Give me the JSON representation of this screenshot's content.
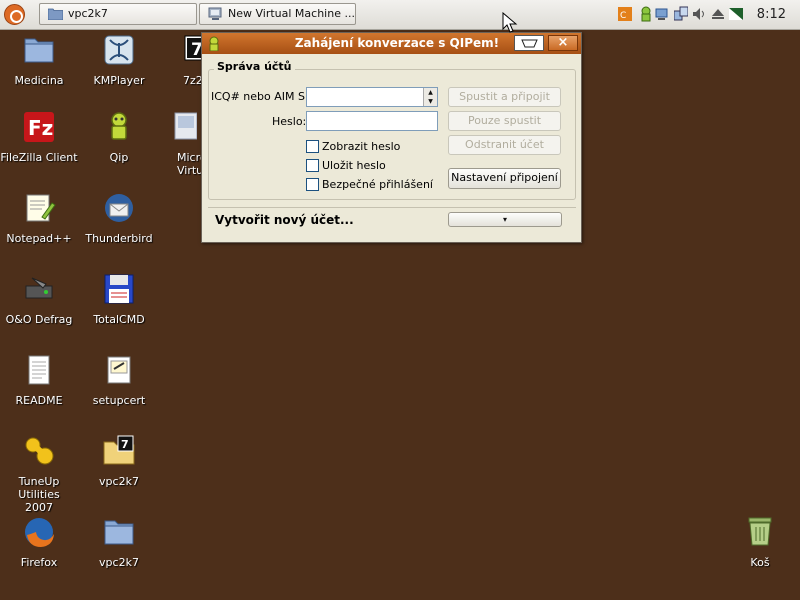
{
  "taskbar": {
    "tasks": [
      {
        "label": "vpc2k7"
      },
      {
        "label": "New Virtual Machine ..."
      }
    ],
    "clock": "8:12"
  },
  "desktop": {
    "icons": [
      {
        "label": "Medicina",
        "icon": "folder-icon"
      },
      {
        "label": "KMPlayer",
        "icon": "kmplayer-icon"
      },
      {
        "label": "7z2",
        "icon": "7zip-icon"
      },
      {
        "label": "FileZilla Client",
        "icon": "filezilla-icon"
      },
      {
        "label": "Qip",
        "icon": "qip-icon"
      },
      {
        "label": "Micro",
        "label2": "Virtua",
        "icon": "virtual-pc-icon"
      },
      {
        "label": "Notepad++",
        "icon": "notepad-plus-icon"
      },
      {
        "label": "Thunderbird",
        "icon": "thunderbird-icon"
      },
      {
        "label": "O&O Defrag",
        "icon": "defrag-icon"
      },
      {
        "label": "TotalCMD",
        "icon": "floppy-disk-icon"
      },
      {
        "label": "README",
        "icon": "text-document-icon"
      },
      {
        "label": "setupcert",
        "icon": "certificate-icon"
      },
      {
        "label": "TuneUp Utilities",
        "label2": "2007",
        "icon": "tuneup-icon"
      },
      {
        "label": "vpc2k7",
        "icon": "7zip-archive-folder-icon"
      },
      {
        "label": "Firefox",
        "icon": "firefox-icon"
      },
      {
        "label": "vpc2k7",
        "icon": "folder-icon"
      },
      {
        "label": "Koš",
        "icon": "trash-icon"
      }
    ]
  },
  "dialog": {
    "title": "Zahájení konverzace s QIPem!",
    "group_label": "Správa účtů",
    "uin_label": "ICQ# nebo AIM SN",
    "uin_value": "",
    "password_label": "Heslo:",
    "password_value": "",
    "checkboxes": [
      {
        "label": "Zobrazit heslo",
        "checked": false
      },
      {
        "label": "Uložit heslo",
        "checked": false
      },
      {
        "label": "Bezpečné přihlášení",
        "checked": false
      }
    ],
    "buttons": {
      "connect": "Spustit a připojit",
      "start_only": "Pouze spustit",
      "remove_account": "Odstranit účet",
      "connection_settings": "Nastavení připojení"
    },
    "new_account": "Vytvořit nový účet...",
    "dropdown_arrow": "▾"
  },
  "colors": {
    "desktop_bg": "#4d2f1a",
    "title_bar": "#c0601f",
    "panel": "#e8e6e1"
  }
}
